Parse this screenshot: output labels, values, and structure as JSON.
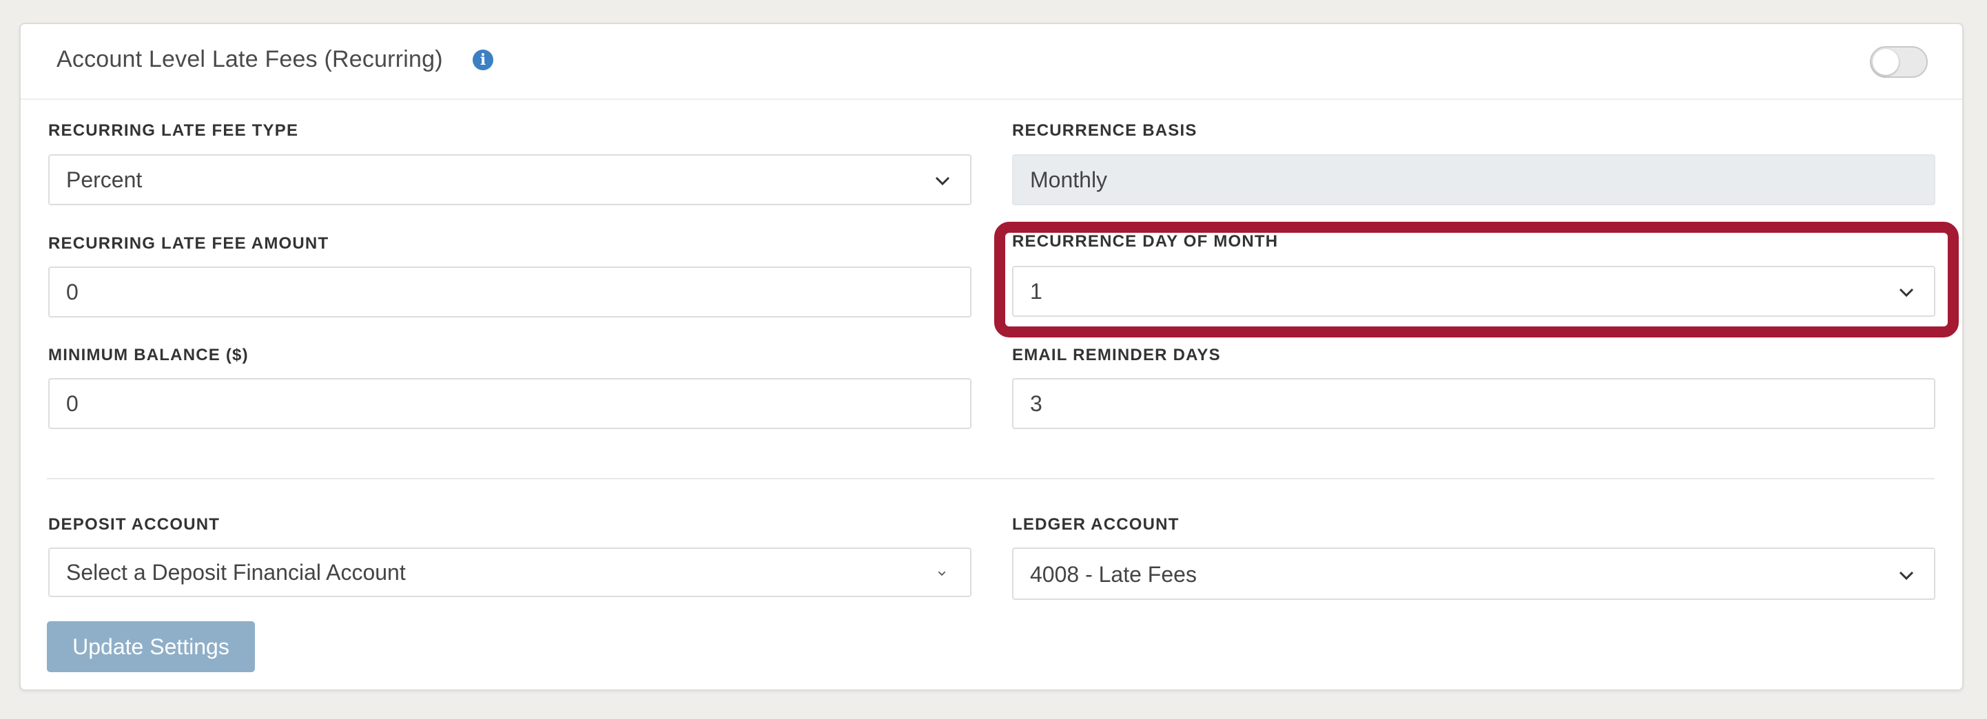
{
  "header": {
    "title": "Account Level Late Fees (Recurring)",
    "info_icon": "info-icon",
    "toggle_on": false
  },
  "fields": {
    "recurring_late_fee_type": {
      "label": "RECURRING LATE FEE TYPE",
      "value": "Percent"
    },
    "recurrence_basis": {
      "label": "RECURRENCE BASIS",
      "value": "Monthly"
    },
    "recurring_late_fee_amount": {
      "label": "RECURRING LATE FEE AMOUNT",
      "value": "0"
    },
    "recurrence_day_of_month": {
      "label": "RECURRENCE DAY OF MONTH",
      "value": "1"
    },
    "minimum_balance": {
      "label": "MINIMUM BALANCE ($)",
      "value": "0"
    },
    "email_reminder_days": {
      "label": "EMAIL REMINDER DAYS",
      "value": "3"
    },
    "deposit_account": {
      "label": "DEPOSIT ACCOUNT",
      "placeholder": "Select a Deposit Financial Account"
    },
    "ledger_account": {
      "label": "LEDGER ACCOUNT",
      "value": "4008 - Late Fees"
    }
  },
  "actions": {
    "update_label": "Update Settings"
  },
  "colors": {
    "highlight": "#a41a33",
    "button": "#8fafc8",
    "info": "#3b7fc4"
  }
}
